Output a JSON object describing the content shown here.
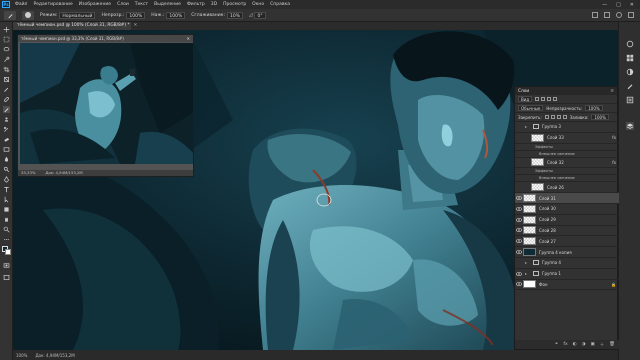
{
  "menubar": {
    "logo": "Ps",
    "items": [
      "Файл",
      "Редактирование",
      "Изображение",
      "Слои",
      "Текст",
      "Выделение",
      "Фильтр",
      "3D",
      "Просмотр",
      "Окно",
      "Справка"
    ],
    "window_controls": [
      "—",
      "□",
      "✕"
    ]
  },
  "options": {
    "mode_label": "Режим:",
    "mode_value": "Нормальный",
    "opacity_label": "Непрозр.:",
    "opacity_value": "100%",
    "flow_label": "Наж.:",
    "flow_value": "100%",
    "smoothing_label": "Сглаживание:",
    "smoothing_value": "10%",
    "angle_value": "0°"
  },
  "document": {
    "tab_title": "тёмный чемпион.psd @ 100% (Слой 31, RGB/8#) *",
    "zoom": "100%",
    "doc_size": "Док: 4,94М/153,2М"
  },
  "navigator": {
    "title": "тёмный чемпион.psd @ 33,3% (Слой 31, RGB/8#)",
    "zoom": "33,33%",
    "doc_size": "Док: 4,94М/153,2М"
  },
  "layers_panel": {
    "title": "Слои",
    "kind_label": "Вид",
    "blend_mode": "Обычные",
    "opacity_label": "Непрозрачность:",
    "opacity_value": "100%",
    "lock_label": "Закрепить:",
    "fill_label": "Заливка:",
    "fill_value": "100%",
    "layers": [
      {
        "name": "Группа 3",
        "type": "group",
        "visible": false
      },
      {
        "name": "Слой 33",
        "type": "layer",
        "visible": false,
        "fx": true
      },
      {
        "name": "Эффекты",
        "type": "effects"
      },
      {
        "name": "Внешнее свечение",
        "type": "effect"
      },
      {
        "name": "Слой 32",
        "type": "layer",
        "visible": false,
        "fx": true
      },
      {
        "name": "Эффекты",
        "type": "effects"
      },
      {
        "name": "Внешнее свечение",
        "type": "effect"
      },
      {
        "name": "Слой 26",
        "type": "layer",
        "visible": false
      },
      {
        "name": "Слой 31",
        "type": "layer",
        "visible": true,
        "selected": true
      },
      {
        "name": "Слой 30",
        "type": "layer",
        "visible": true
      },
      {
        "name": "Слой 29",
        "type": "layer",
        "visible": true
      },
      {
        "name": "Слой 28",
        "type": "layer",
        "visible": true
      },
      {
        "name": "Слой 27",
        "type": "layer",
        "visible": true
      },
      {
        "name": "Группа 4 копия",
        "type": "layer",
        "visible": true,
        "dark": true
      },
      {
        "name": "Группа 4",
        "type": "group",
        "visible": false
      },
      {
        "name": "Группа 1",
        "type": "group",
        "visible": true
      },
      {
        "name": "Фон",
        "type": "layer",
        "visible": true,
        "white": true
      }
    ],
    "fx_label": "fx",
    "footer_icons": [
      "⚭",
      "fx",
      "◐",
      "◑",
      "▣",
      "＋",
      "🗑"
    ]
  }
}
